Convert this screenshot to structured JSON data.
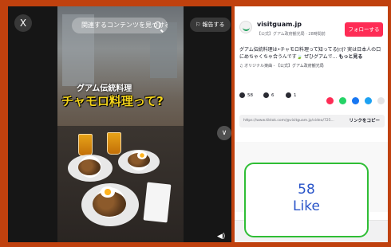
{
  "video": {
    "search_placeholder": "関連するコンテンツを見つける",
    "report_label": "報告する",
    "close_glyph": "X",
    "title_small": "グアム伝統料理",
    "title_big": "チャモロ料理って?"
  },
  "account": {
    "username": "visitguam.jp",
    "subline": "【公式】グアム政府観光局 · 28時間前",
    "follow_label": "フォローする"
  },
  "description": {
    "text": "グアム伝統料理は•チャモロ料理って知ってる🍽? 実は日本人の口にめちゃくちゃ合うんです🍃 ぜひグアムで...",
    "more_label": "もっと見る",
    "music": "♫ オリジナル楽曲 - 【公式】グアム政府観光局"
  },
  "stats": {
    "likes": "58",
    "comments": "6",
    "saves": "1"
  },
  "link": {
    "url": "https://www.tiktok.com/@visitguam.jp/video/725...",
    "copy_label": "リンクをコピー"
  },
  "overlay": {
    "count": "58",
    "label": "Like"
  },
  "colors": {
    "accent": "#fe2c55",
    "frame": "#c0410e",
    "like_box_border": "#2fbe35",
    "like_box_text": "#2a55c9"
  },
  "share_icon_colors": [
    "#fe2c55",
    "#25d366",
    "#1877f2",
    "#1da1f2"
  ]
}
